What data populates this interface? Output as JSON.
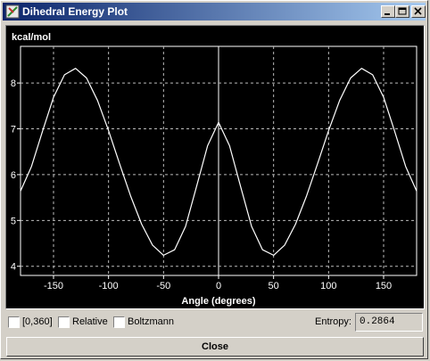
{
  "window": {
    "title": "Dihedral Energy Plot",
    "icon": "app-icon"
  },
  "title_buttons": [
    "minimize-icon",
    "maximize-icon",
    "close-icon"
  ],
  "chart_data": {
    "type": "line",
    "title": "",
    "xlabel": "Angle (degrees)",
    "ylabel": "kcal/mol",
    "xlim": [
      -180,
      180
    ],
    "ylim": [
      3.8,
      8.8
    ],
    "xticks": [
      -150,
      -100,
      -50,
      0,
      50,
      100,
      150
    ],
    "yticks": [
      4,
      5,
      6,
      7,
      8
    ],
    "grid": true,
    "background": "#000000",
    "line_color": "#ffffff",
    "grid_color": "#bbbbbb",
    "series": [
      {
        "x": [
          -180,
          -170,
          -160,
          -150,
          -140,
          -130,
          -120,
          -110,
          -100,
          -90,
          -80,
          -70,
          -60,
          -50,
          -40,
          -30,
          -20,
          -10,
          0,
          10,
          20,
          30,
          40,
          50,
          60,
          70,
          80,
          90,
          100,
          110,
          120,
          130,
          140,
          150,
          160,
          170,
          180
        ],
        "y": [
          5.64,
          6.18,
          6.95,
          7.69,
          8.18,
          8.32,
          8.11,
          7.62,
          6.96,
          6.24,
          5.54,
          4.92,
          4.46,
          4.24,
          4.36,
          4.87,
          5.74,
          6.63,
          7.14,
          6.63,
          5.74,
          4.87,
          4.36,
          4.24,
          4.46,
          4.92,
          5.54,
          6.24,
          6.96,
          7.62,
          8.11,
          8.32,
          8.18,
          7.69,
          6.95,
          6.18,
          5.64
        ]
      }
    ]
  },
  "options": {
    "range_label": "[0,360]",
    "relative_label": "Relative",
    "boltzmann_label": "Boltzmann",
    "entropy_label": "Entropy:",
    "entropy_value": "0.2864"
  },
  "close_label": "Close"
}
